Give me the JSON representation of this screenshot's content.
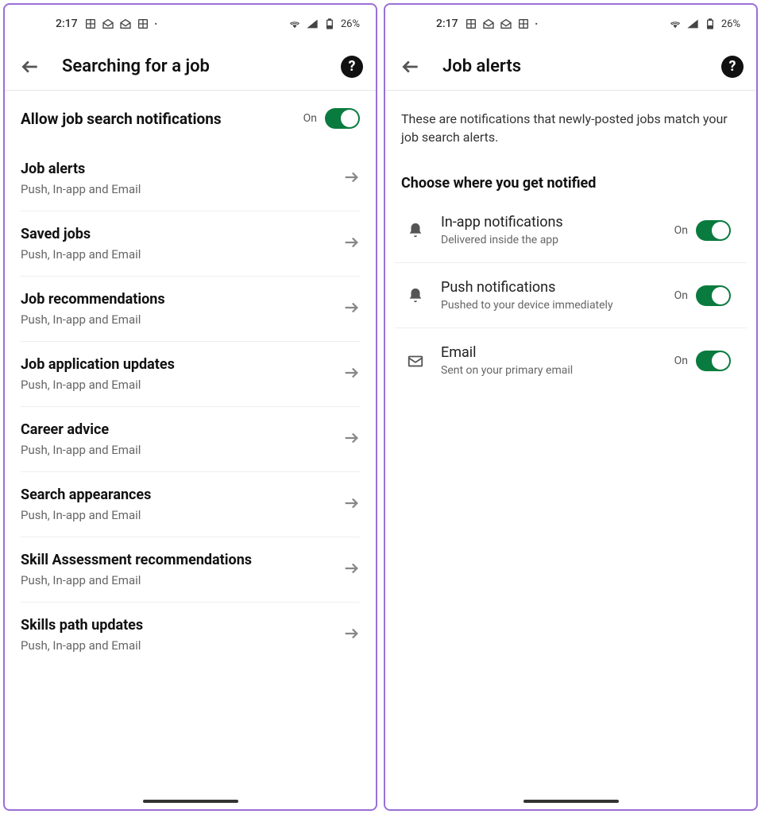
{
  "statusBar": {
    "time": "2:17",
    "battery": "26%"
  },
  "left": {
    "title": "Searching for a job",
    "master": {
      "label": "Allow job search notifications",
      "state": "On"
    },
    "items": [
      {
        "title": "Job alerts",
        "sub": "Push, In-app and Email"
      },
      {
        "title": "Saved jobs",
        "sub": "Push, In-app and Email"
      },
      {
        "title": "Job recommendations",
        "sub": "Push, In-app and Email"
      },
      {
        "title": "Job application updates",
        "sub": "Push, In-app and Email"
      },
      {
        "title": "Career advice",
        "sub": "Push, In-app and Email"
      },
      {
        "title": "Search appearances",
        "sub": "Push, In-app and Email"
      },
      {
        "title": "Skill Assessment recommendations",
        "sub": "Push, In-app and Email"
      },
      {
        "title": "Skills path updates",
        "sub": "Push, In-app and Email"
      }
    ]
  },
  "right": {
    "title": "Job alerts",
    "description": "These are notifications that newly-posted jobs match your job search alerts.",
    "sectionHeader": "Choose where you get notified",
    "channels": [
      {
        "title": "In-app notifications",
        "sub": "Delivered inside the app",
        "state": "On",
        "icon": "bell"
      },
      {
        "title": "Push notifications",
        "sub": "Pushed to your device immediately",
        "state": "On",
        "icon": "bell"
      },
      {
        "title": "Email",
        "sub": "Sent on your primary email",
        "state": "On",
        "icon": "mail"
      }
    ]
  }
}
